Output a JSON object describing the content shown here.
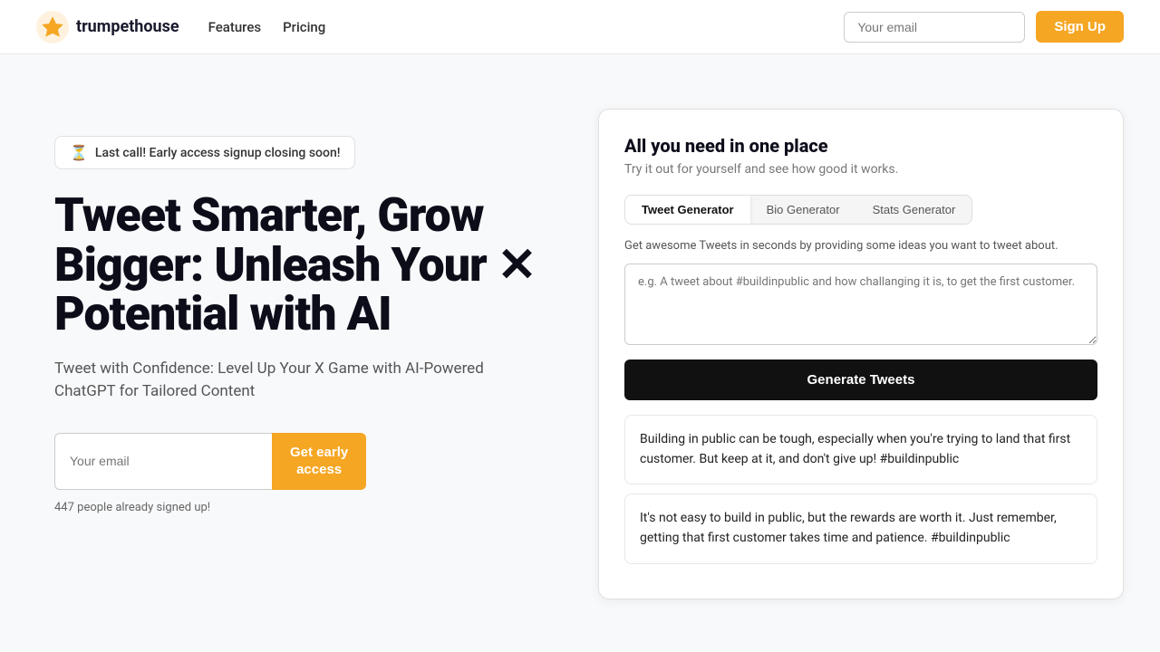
{
  "brand": {
    "name": "trumpethouse",
    "logo_alt": "trumpethouse logo"
  },
  "navbar": {
    "features_label": "Features",
    "pricing_label": "Pricing",
    "email_placeholder": "Your email",
    "signup_label": "Sign Up"
  },
  "hero": {
    "badge_icon": "⏳",
    "badge_text": "Last call! Early access signup closing soon!",
    "title_line1": "Tweet Smarter, Grow",
    "title_line2": "Bigger: Unleash Your",
    "title_line3": "Potential with AI",
    "title_x": "✕",
    "subtitle": "Tweet with Confidence: Level Up Your X Game with AI-Powered ChatGPT for Tailored Content",
    "email_placeholder": "Your email",
    "cta_label_line1": "Get early",
    "cta_label_line2": "access",
    "signup_count": "447 people already signed up!"
  },
  "demo": {
    "title": "All you need in one place",
    "subtitle": "Try it out for yourself and see how good it works.",
    "tabs": [
      {
        "label": "Tweet Generator",
        "active": true
      },
      {
        "label": "Bio Generator",
        "active": false
      },
      {
        "label": "Stats Generator",
        "active": false
      }
    ],
    "description": "Get awesome Tweets in seconds by providing some ideas you want to tweet about.",
    "textarea_placeholder": "e.g. A tweet about #buildinpublic and how challanging it is, to get the first customer.",
    "generate_btn": "Generate Tweets",
    "results": [
      {
        "text": "Building in public can be tough, especially when you're trying to land that first customer. But keep at it, and don't give up! #buildinpublic"
      },
      {
        "text": "It's not easy to build in public, but the rewards are worth it. Just remember, getting that first customer takes time and patience. #buildinpublic"
      }
    ]
  }
}
